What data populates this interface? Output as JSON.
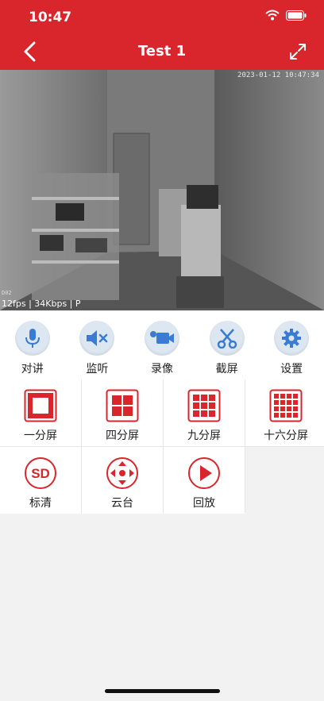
{
  "status": {
    "time": "10:47"
  },
  "nav": {
    "title": "Test 1",
    "back_icon": "chevron-left-icon",
    "fullscreen_icon": "expand-icon"
  },
  "video": {
    "timestamp": "2023-01-12 10:47:34",
    "channel": "D02",
    "stats": "12fps | 34Kbps | P"
  },
  "controls": [
    {
      "label": "对讲",
      "icon": "microphone-icon"
    },
    {
      "label": "监听",
      "icon": "speaker-muted-icon"
    },
    {
      "label": "录像",
      "icon": "video-camera-icon"
    },
    {
      "label": "截屏",
      "icon": "scissors-icon"
    },
    {
      "label": "设置",
      "icon": "gear-icon"
    }
  ],
  "layouts": [
    {
      "label": "一分屏",
      "icon": "one-split-icon"
    },
    {
      "label": "四分屏",
      "icon": "four-split-icon"
    },
    {
      "label": "九分屏",
      "icon": "nine-split-icon"
    },
    {
      "label": "十六分屏",
      "icon": "sixteen-split-icon"
    },
    {
      "label": "标清",
      "icon": "sd-icon"
    },
    {
      "label": "云台",
      "icon": "ptz-icon"
    },
    {
      "label": "回放",
      "icon": "play-icon"
    }
  ],
  "colors": {
    "brand_red": "#d9262c",
    "icon_blue": "#3a7bd5"
  }
}
